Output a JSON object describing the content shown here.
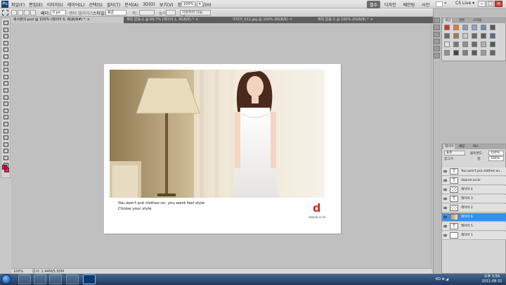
{
  "menubar": {
    "logo": "Ps",
    "items": [
      "파일(F)",
      "편집(E)",
      "이미지(I)",
      "레이어(L)",
      "선택(S)",
      "필터(T)",
      "분석(A)",
      "3D(D)",
      "보기(V)",
      "창(W)",
      "도움말(H)"
    ],
    "zoom": "100%",
    "arrange": "▾"
  },
  "workspace": {
    "items": [
      "필수",
      "디자인",
      "페인팅",
      "사진"
    ],
    "active": 0,
    "more": "»"
  },
  "cslive": "CS Live ▾",
  "options": {
    "feather_label": "페더:",
    "feather_value": "0 px",
    "antialias_label": "앤티 앨리어스",
    "style_label": "스타일:",
    "style_value": "표준",
    "width_label": "폭:",
    "height_label": "높이:",
    "refine_label": "가장자리 다듬기..."
  },
  "tabs": [
    {
      "label": "복사본의.psd @ 100% (레이어 6, RGB/8#) *",
      "close": "×"
    },
    {
      "label": "제목 없음-1 @ 66.7% (레이어 1, RGB/8) *",
      "close": "×"
    },
    {
      "label": "이미지_012.jpg @ 100% (RGB/8)",
      "close": "×"
    },
    {
      "label": "제목 없음-3 @ 100% (RGB/8) *",
      "close": "×"
    }
  ],
  "document": {
    "tagline": "You won't put clothes on, you want feel style",
    "tagline2": "Choise your style",
    "logo_letter": "d",
    "logo_url": "dazure.co.kr"
  },
  "statusbar": {
    "zoom": "100%",
    "doc": "문서: 1.44M/5.95M"
  },
  "panels": {
    "swatch_tabs": [
      "색상",
      "견본",
      "스타일"
    ],
    "layer_tabs": [
      "레이어",
      "채널",
      "패스"
    ],
    "blend_mode": "표준",
    "opacity_label": "불투명도:",
    "opacity": "100%",
    "lock_label": "잠그기:",
    "fill_label": "칠:",
    "fill": "100%",
    "swatch_colors": [
      "#d9342b",
      "#e97a2b",
      "#8a9bb4",
      "#8ea3d2",
      "#6f86b7",
      "#5a5a5a",
      "#7a6a5c",
      "#a47a4b",
      "#c9c9c9",
      "#6b6b6b",
      "#5d5d5d",
      "#4f6e8f",
      "#e2e2e2",
      "#777777",
      "#8f8f8f",
      "#696969",
      "#b0b0b0",
      "#555555",
      "#8e8e8e",
      "#444444",
      "#7d7d7d",
      "#5b5b5b",
      "#9a9a9a",
      "#666666"
    ]
  },
  "layers": [
    {
      "name": "You won't put clothes on...",
      "type": "T",
      "selected": false
    },
    {
      "name": "dazure.co.kr",
      "type": "T",
      "selected": false
    },
    {
      "name": "레이어 4",
      "type": "check",
      "selected": false
    },
    {
      "name": "레이어 3",
      "type": "T",
      "selected": false
    },
    {
      "name": "레이어 2",
      "type": "check",
      "selected": false
    },
    {
      "name": "레이어 6",
      "type": "photo",
      "selected": true
    },
    {
      "name": "레이어 5",
      "type": "T",
      "selected": false
    },
    {
      "name": "레이어 1",
      "type": "blank",
      "selected": false
    }
  ],
  "taskbar": {
    "tray": "KO ⊕ ◢",
    "time": "오후 3:56",
    "date": "2011-08-31"
  }
}
